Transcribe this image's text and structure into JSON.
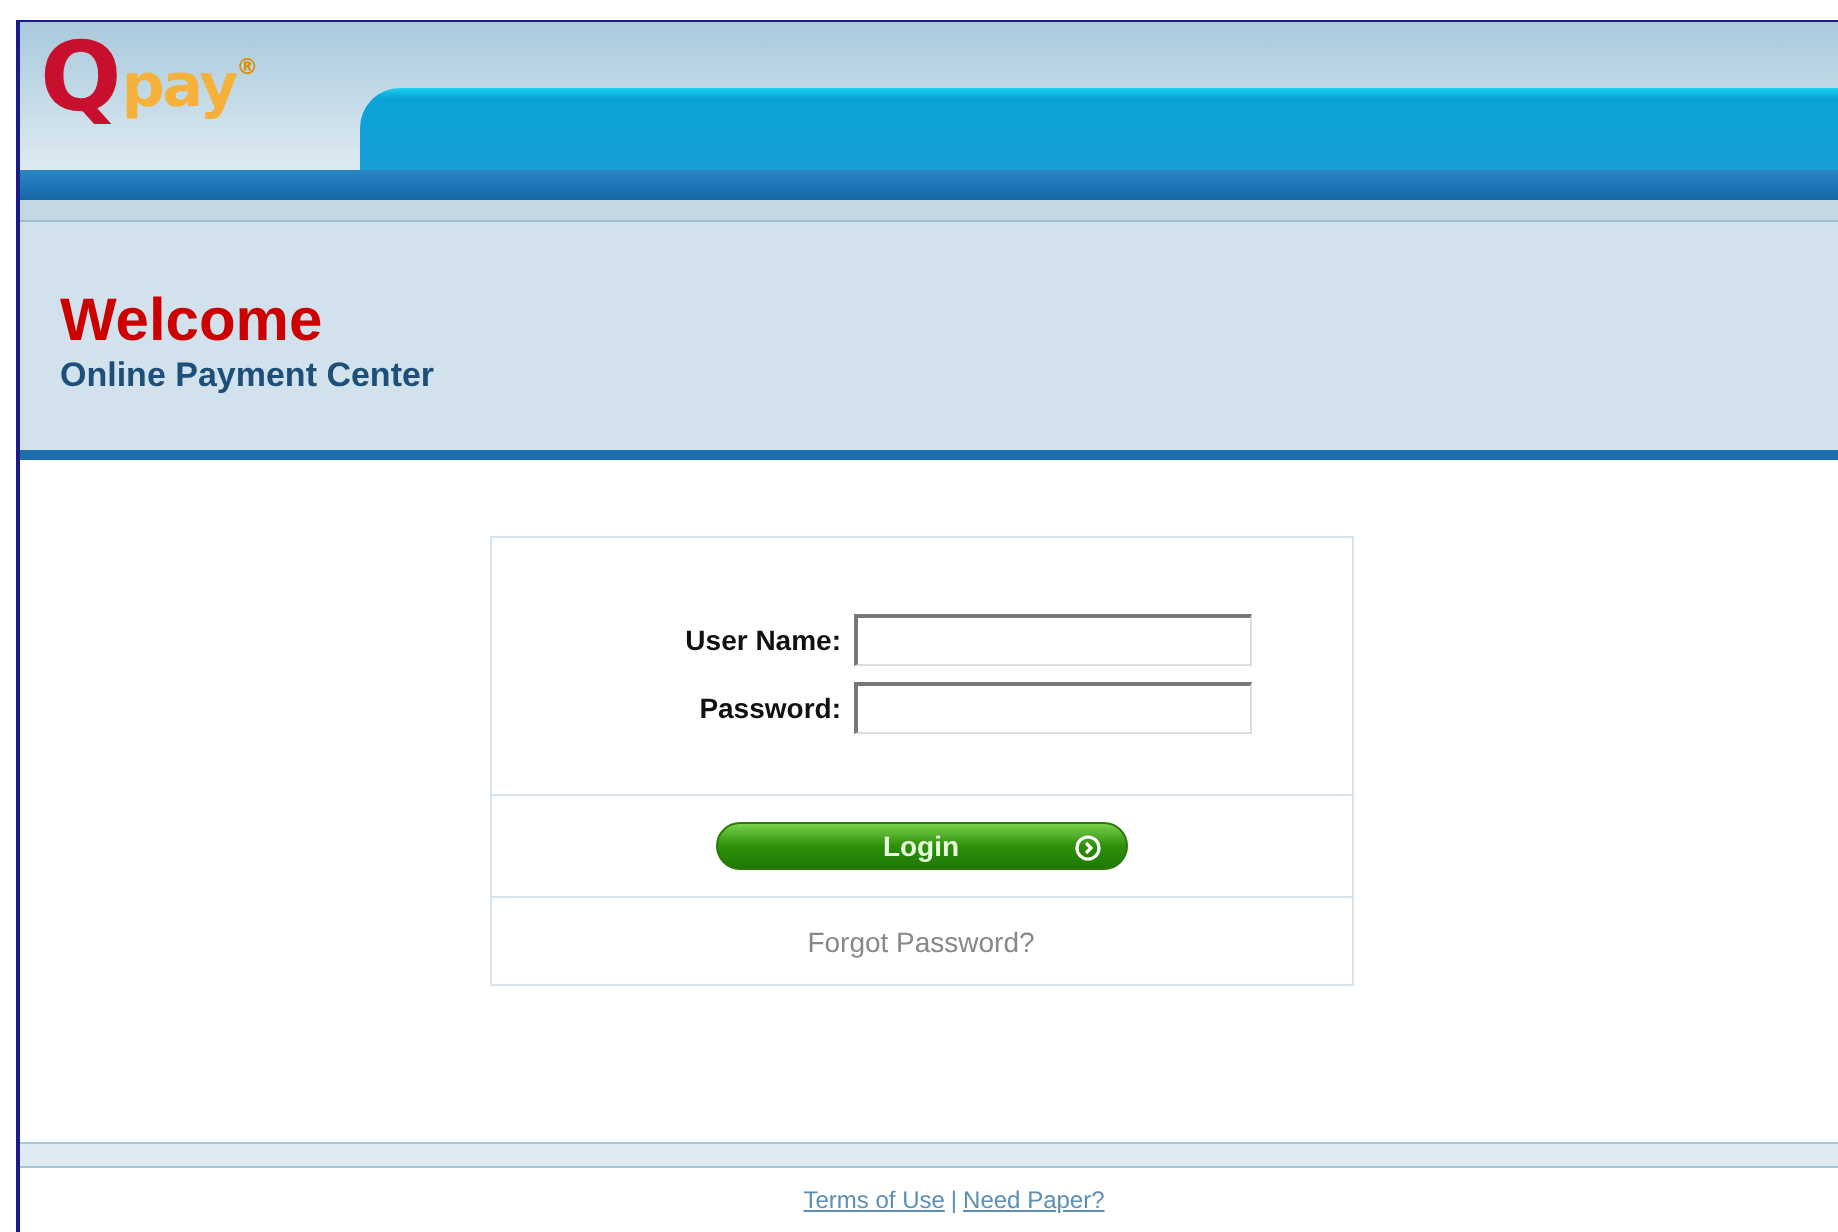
{
  "logo": {
    "letter": "Q",
    "word": "pay",
    "mark": "®"
  },
  "welcome": {
    "title": "Welcome",
    "subtitle": "Online Payment Center"
  },
  "login_form": {
    "fields": [
      {
        "label": "User Name:"
      },
      {
        "label": "Password:"
      }
    ],
    "button": "Login",
    "forgot_link": "Forgot Password?"
  },
  "footer": {
    "links": [
      "Terms of Use",
      "Need Paper?"
    ],
    "separator": "|"
  }
}
